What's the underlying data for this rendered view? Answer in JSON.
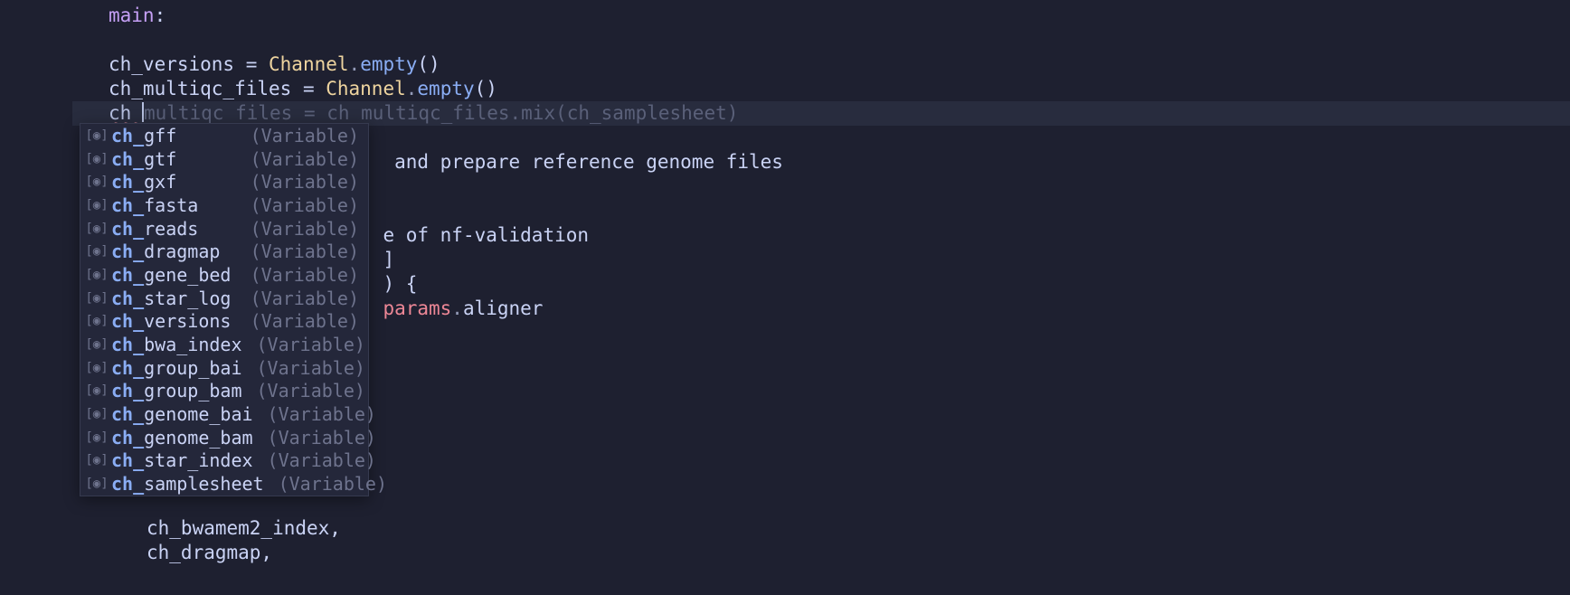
{
  "code": {
    "main_label": "main",
    "colon": ":",
    "line1_lhs": "ch_versions",
    "assign": " = ",
    "channel": "Channel",
    "dot": ".",
    "empty": "empty",
    "parens": "()",
    "line2_lhs": "ch_multiqc_files",
    "line3_typed": "ch_",
    "line3_ghost": "multiqc_files = ch_multiqc_files.mix(ch_samplesheet)",
    "hidden1_tail": " and prepare reference genome files",
    "hidden2_tail": "e of nf-validation",
    "hidden3_tail": "]",
    "hidden4_tail": ") {",
    "params": "params",
    "aligner": "aligner",
    "tail_line1": "ch_bwamem2_index,",
    "tail_line2": "ch_dragmap,"
  },
  "autocomplete": {
    "match_prefix": "ch_",
    "kind_label": "(Variable)",
    "items": [
      {
        "rest": "gff"
      },
      {
        "rest": "gtf"
      },
      {
        "rest": "gxf"
      },
      {
        "rest": "fasta"
      },
      {
        "rest": "reads"
      },
      {
        "rest": "dragmap"
      },
      {
        "rest": "gene_bed"
      },
      {
        "rest": "star_log"
      },
      {
        "rest": "versions"
      },
      {
        "rest": "bwa_index"
      },
      {
        "rest": "group_bai"
      },
      {
        "rest": "group_bam"
      },
      {
        "rest": "genome_bai"
      },
      {
        "rest": "genome_bam"
      },
      {
        "rest": "star_index"
      },
      {
        "rest": "samplesheet"
      }
    ]
  }
}
